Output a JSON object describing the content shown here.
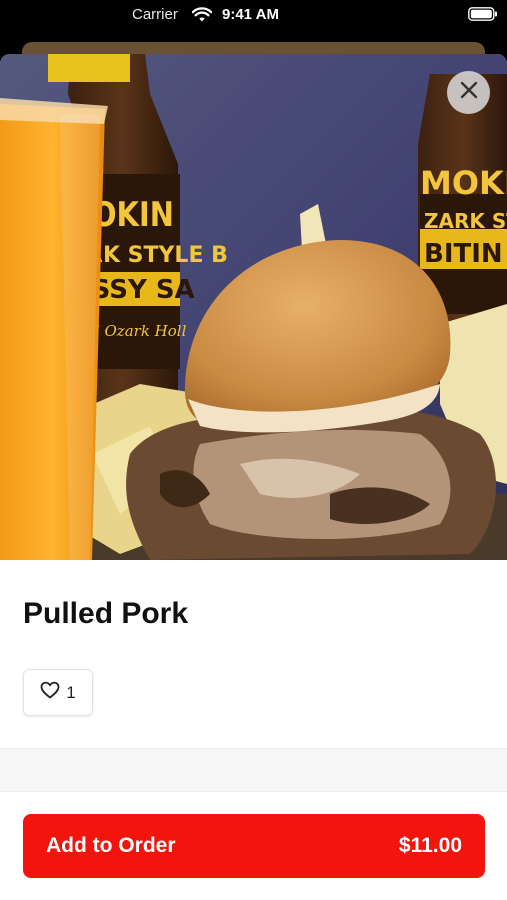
{
  "status_bar": {
    "carrier": "Carrier",
    "time": "9:41 AM"
  },
  "item": {
    "title": "Pulled Pork",
    "image_labels": {
      "bottle_left": [
        "OKIN",
        "RK STYLE B",
        "ISSY SA",
        "al Ozark Holl"
      ],
      "bottle_right": [
        "MOKIN",
        "ZARK STY",
        "BITIN"
      ]
    }
  },
  "like": {
    "count": "1"
  },
  "order_button": {
    "label": "Add to Order",
    "price": "$11.00"
  },
  "colors": {
    "accent": "#f3140e",
    "status_bar_bg": "#000000",
    "sheet_bg": "#ffffff"
  },
  "icons": {
    "close": "close-icon",
    "like": "heart-icon",
    "wifi": "wifi-icon",
    "battery": "battery-icon"
  }
}
